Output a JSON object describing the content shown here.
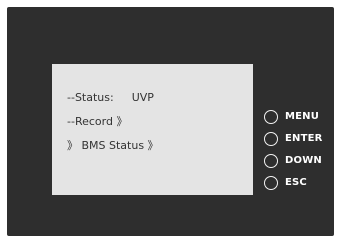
{
  "lcd": {
    "status_label": "--Status:",
    "status_value": "UVP",
    "record_item": "--Record 》",
    "bms_item": "》 BMS Status 》"
  },
  "buttons": {
    "menu": "MENU",
    "enter": "ENTER",
    "down": "DOWN",
    "esc": "ESC"
  },
  "colors": {
    "panel": "#2e2e2e",
    "screen": "#e4e4e4",
    "screen_text": "#333333",
    "button_text": "#ffffff"
  }
}
